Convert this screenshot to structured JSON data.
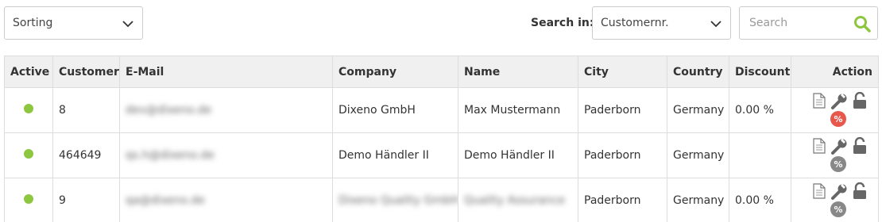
{
  "toolbar": {
    "sorting_value": "Sorting",
    "search_in_label": "Search in:",
    "search_in_value": "Customernr.",
    "search_placeholder": "Search"
  },
  "table": {
    "headers": [
      "Active",
      "Customer",
      "E-Mail",
      "Company",
      "Name",
      "City",
      "Country",
      "Discount",
      "Action"
    ],
    "rows": [
      {
        "customer": "8",
        "email": "dev@dixeno.de",
        "company": "Dixeno GmbH",
        "name": "Max Mustermann",
        "city": "Paderborn",
        "country": "Germany",
        "discount": "0.00 %",
        "discount_color": "#e8574b"
      },
      {
        "customer": "464649",
        "email": "qs.h@dixeno.de",
        "company": "Demo Händler II",
        "name": "Demo Händler II",
        "city": "Paderborn",
        "country": "Germany",
        "discount": "",
        "discount_color": "#888888"
      },
      {
        "customer": "9",
        "email": "qa@dixeno.de",
        "company": "Dixeno Quality GmbH",
        "name": "Quality Assurance",
        "city": "Paderborn",
        "country": "Germany",
        "discount": "0.00 %",
        "discount_color": "#888888"
      }
    ]
  },
  "colors": {
    "accent": "#8dc63f",
    "discount_active": "#e8574b",
    "discount_inactive": "#888888"
  },
  "icons": {
    "percent_glyph": "%"
  }
}
